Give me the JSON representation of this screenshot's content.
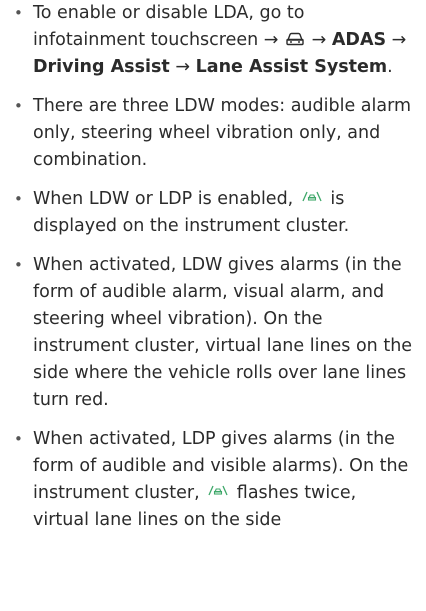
{
  "bullet_glyph": "•",
  "items": [
    {
      "pre": "To enable or disable LDA, go to infotainment touchscreen →",
      "arrow1": "→",
      "path1": "ADAS",
      "arrow2": "→",
      "path2": "Driving Assist",
      "arrow3": "→",
      "path3": "Lane Assist System",
      "end": "."
    },
    {
      "text": "There are three LDW modes: audible alarm only, steering wheel vibration only, and combination."
    },
    {
      "pre": "When LDW or LDP is enabled,",
      "post": "is displayed on the instrument cluster."
    },
    {
      "text": "When activated, LDW gives alarms (in the form of audible alarm, visual alarm, and steering wheel vibration). On the instrument cluster, virtual lane lines on the side where the vehicle rolls over lane lines turn red."
    },
    {
      "pre": "When activated, LDP gives alarms (in the form of audible and visible alarms). On the instrument cluster,",
      "post": "flashes twice, virtual lane lines on the side"
    }
  ],
  "icons": {
    "car": "car-settings-icon",
    "lane": "lane-assist-icon",
    "lane_color": "#3fa86a"
  }
}
